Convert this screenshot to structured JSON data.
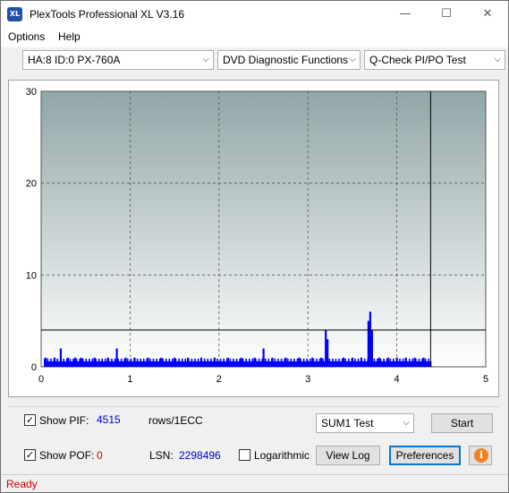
{
  "window": {
    "title": "PlexTools Professional XL V3.16",
    "icon_text": "XL",
    "minimize": "—",
    "maximize": "☐",
    "close": "✕"
  },
  "menu": {
    "options": "Options",
    "help": "Help"
  },
  "toolbar": {
    "drive": "HA:8 ID:0  PX-760A",
    "function": "DVD Diagnostic Functions",
    "test": "Q-Check PI/PO Test"
  },
  "chart_data": {
    "type": "bar",
    "x_ticks": [
      "0",
      "1",
      "2",
      "3",
      "4",
      "5"
    ],
    "y_ticks": [
      "0",
      "10",
      "20",
      "30"
    ],
    "xlim": [
      0,
      5
    ],
    "ylim": [
      0,
      30
    ],
    "threshold_y": 4,
    "end_marker_x": 4.38,
    "grid": true,
    "bar_color": "#0000ff",
    "spikes": [
      {
        "x": 0.05,
        "y": 1
      },
      {
        "x": 0.15,
        "y": 1
      },
      {
        "x": 0.22,
        "y": 2
      },
      {
        "x": 0.3,
        "y": 1
      },
      {
        "x": 0.38,
        "y": 1
      },
      {
        "x": 0.45,
        "y": 1
      },
      {
        "x": 0.6,
        "y": 1
      },
      {
        "x": 0.75,
        "y": 1
      },
      {
        "x": 0.85,
        "y": 2
      },
      {
        "x": 0.95,
        "y": 1
      },
      {
        "x": 1.05,
        "y": 1
      },
      {
        "x": 1.2,
        "y": 1
      },
      {
        "x": 1.35,
        "y": 1
      },
      {
        "x": 1.5,
        "y": 1
      },
      {
        "x": 1.65,
        "y": 1
      },
      {
        "x": 1.8,
        "y": 1
      },
      {
        "x": 1.95,
        "y": 1
      },
      {
        "x": 2.1,
        "y": 1
      },
      {
        "x": 2.25,
        "y": 1
      },
      {
        "x": 2.4,
        "y": 1
      },
      {
        "x": 2.5,
        "y": 2
      },
      {
        "x": 2.6,
        "y": 1
      },
      {
        "x": 2.75,
        "y": 1
      },
      {
        "x": 2.9,
        "y": 1
      },
      {
        "x": 3.05,
        "y": 1
      },
      {
        "x": 3.15,
        "y": 1
      },
      {
        "x": 3.2,
        "y": 4
      },
      {
        "x": 3.22,
        "y": 3
      },
      {
        "x": 3.4,
        "y": 1
      },
      {
        "x": 3.5,
        "y": 1
      },
      {
        "x": 3.6,
        "y": 1
      },
      {
        "x": 3.68,
        "y": 5
      },
      {
        "x": 3.7,
        "y": 6
      },
      {
        "x": 3.72,
        "y": 4
      },
      {
        "x": 3.8,
        "y": 1
      },
      {
        "x": 3.9,
        "y": 1
      },
      {
        "x": 4.0,
        "y": 1
      },
      {
        "x": 4.1,
        "y": 1
      },
      {
        "x": 4.2,
        "y": 1
      },
      {
        "x": 4.3,
        "y": 1
      }
    ],
    "baseline_y": 1
  },
  "controls": {
    "show_pif_label": "Show PIF:",
    "show_pif_checked": "✓",
    "pif_value": "4515",
    "pif_unit": "rows/1ECC",
    "show_pof_label": "Show POF:",
    "show_pof_checked": "✓",
    "pof_value": "0",
    "lsn_label": "LSN:",
    "lsn_value": "2298496",
    "logarithmic_label": "Logarithmic",
    "sum_select": "SUM1 Test",
    "start_button": "Start",
    "view_log_button": "View Log",
    "preferences_button": "Preferences",
    "info_glyph": "i"
  },
  "status": {
    "text": "Ready"
  }
}
